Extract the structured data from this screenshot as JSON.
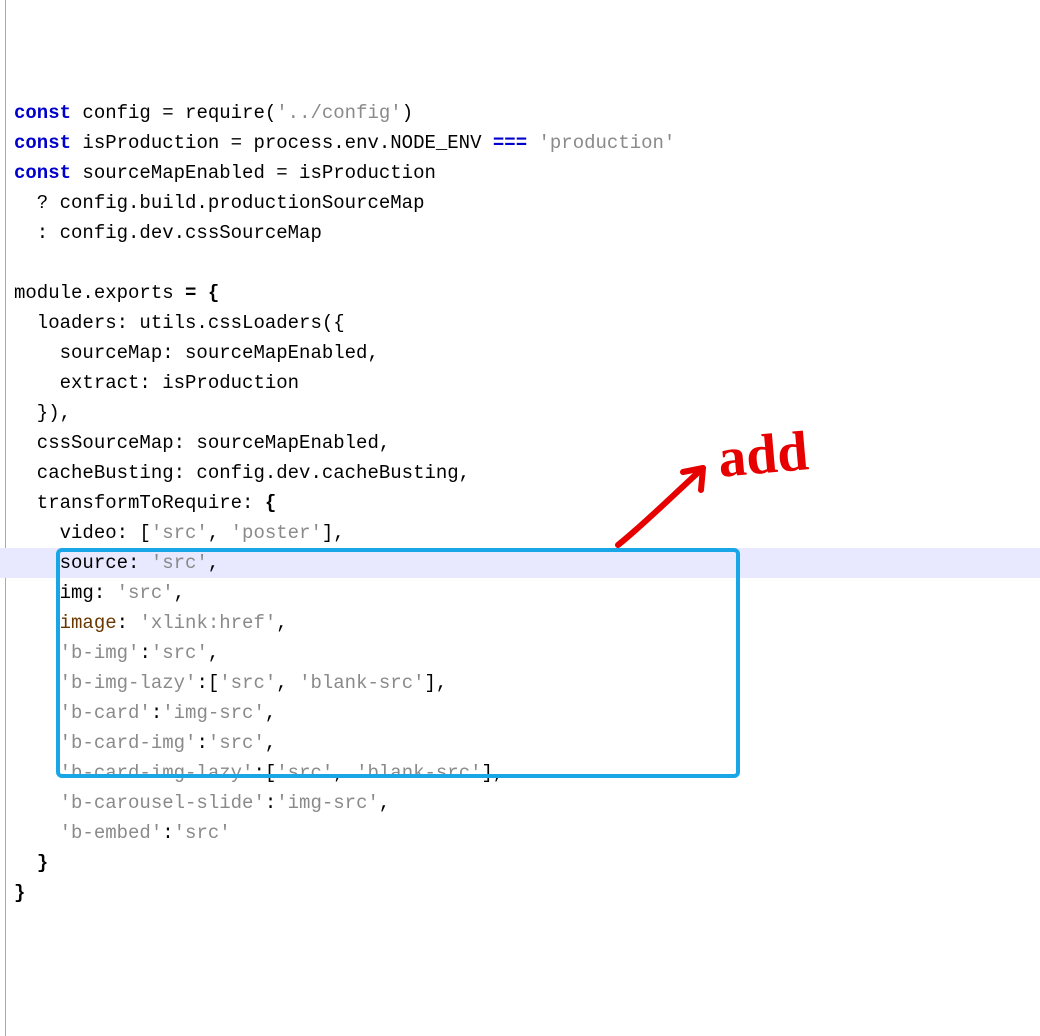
{
  "annotation": {
    "label": "add"
  },
  "code": {
    "lines": [
      {
        "kind": "l1",
        "t1": "const ",
        "t2": "config = require(",
        "t3": "'../config'",
        "t4": ")"
      },
      {
        "kind": "l2",
        "t1": "const ",
        "t2": "isProduction = process.env.NODE_ENV ",
        "t3": "=== ",
        "t4": "'production'"
      },
      {
        "kind": "l3",
        "t1": "const ",
        "t2": "sourceMapEnabled = isProduction"
      },
      {
        "kind": "plain",
        "text": "  ? config.build.productionSourceMap"
      },
      {
        "kind": "plain",
        "text": "  : config.dev.cssSourceMap"
      },
      {
        "kind": "blank",
        "text": ""
      },
      {
        "kind": "plain",
        "text": "module.exports = {",
        "bold": "= {"
      },
      {
        "kind": "plain",
        "text": "  loaders: utils.cssLoaders({"
      },
      {
        "kind": "plain",
        "text": "    sourceMap: sourceMapEnabled,"
      },
      {
        "kind": "plain",
        "text": "    extract: isProduction"
      },
      {
        "kind": "plain",
        "text": "  }),"
      },
      {
        "kind": "plain",
        "text": "  cssSourceMap: sourceMapEnabled,"
      },
      {
        "kind": "plain",
        "text": "  cacheBusting: config.dev.cacheBusting,"
      },
      {
        "kind": "plain",
        "text": "  transformToRequire: {",
        "bold": "{"
      },
      {
        "kind": "kv",
        "pad": "    ",
        "k": "video: [",
        "s1": "'src'",
        "m": ", ",
        "s2": "'poster'",
        "end": "],"
      },
      {
        "kind": "kv",
        "pad": "    ",
        "k": "source: ",
        "s1": "'src'",
        "end": ","
      },
      {
        "kind": "kv",
        "pad": "    ",
        "k": "img: ",
        "s1": "'src'",
        "end": ","
      },
      {
        "kind": "kvp",
        "pad": "    ",
        "kp": "image",
        "k": ": ",
        "s1": "'xlink:href'",
        "end": ","
      },
      {
        "kind": "kvs",
        "pad": "    ",
        "ks": "'b-img'",
        "k": ":",
        "s1": "'src'",
        "end": ","
      },
      {
        "kind": "kvs",
        "pad": "    ",
        "ks": "'b-img-lazy'",
        "k": ":[",
        "s1": "'src'",
        "m": ", ",
        "s2": "'blank-src'",
        "end": "],"
      },
      {
        "kind": "kvs",
        "pad": "    ",
        "ks": "'b-card'",
        "k": ":",
        "s1": "'img-src'",
        "end": ","
      },
      {
        "kind": "kvs",
        "pad": "    ",
        "ks": "'b-card-img'",
        "k": ":",
        "s1": "'src'",
        "end": ","
      },
      {
        "kind": "kvs",
        "pad": "    ",
        "ks": "'b-card-img-lazy'",
        "k": ":[",
        "s1": "'src'",
        "m": ", ",
        "s2": "'blank-src'",
        "end": "],"
      },
      {
        "kind": "kvs",
        "pad": "    ",
        "ks": "'b-carousel-slide'",
        "k": ":",
        "s1": "'img-src'",
        "end": ","
      },
      {
        "kind": "kvs",
        "pad": "    ",
        "ks": "'b-embed'",
        "k": ":",
        "s1": "'src'"
      },
      {
        "kind": "closeb",
        "text": "  }",
        "bold": "}"
      },
      {
        "kind": "closeb",
        "text": "}",
        "bold": "}"
      }
    ],
    "cursor_line_index": 18
  }
}
